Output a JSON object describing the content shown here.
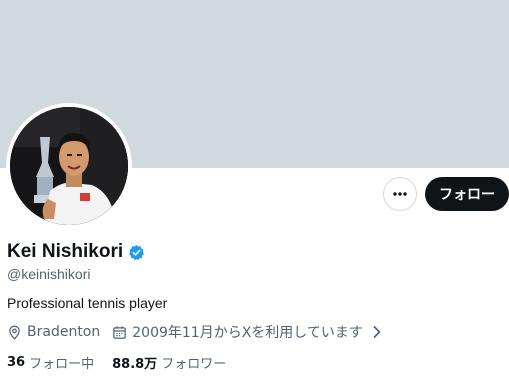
{
  "profile": {
    "display_name": "Kei Nishikori",
    "handle": "@keinishikori",
    "bio": "Professional tennis player",
    "location": "Bradenton",
    "joined": "2009年11月からXを利用しています",
    "verified": true
  },
  "actions": {
    "more_label": "•••",
    "follow_label": "フォロー"
  },
  "stats": {
    "following_count": "36",
    "following_label": "フォロー中",
    "followers_count": "88.8万",
    "followers_label": "フォロワー"
  },
  "icons": {
    "location": "map-pin-icon",
    "calendar": "calendar-icon",
    "verified": "verified-badge-icon",
    "more": "more-horizontal-icon",
    "chevron": "chevron-right-icon"
  },
  "colors": {
    "banner": "#cfd9de",
    "follow_button": "#0f1419",
    "secondary_text": "#536471",
    "verified": "#1d9bf0"
  }
}
